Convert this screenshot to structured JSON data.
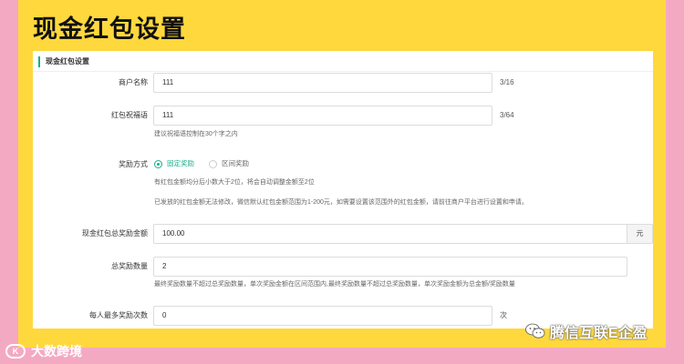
{
  "page_title": "现金红包设置",
  "panel": {
    "title": "现金红包设置"
  },
  "form": {
    "merchant_name": {
      "label": "商户名称",
      "value": "111",
      "counter": "3/16"
    },
    "greeting": {
      "label": "红包祝福语",
      "value": "111",
      "counter": "3/64",
      "hint": "建议祝福语控制在30个字之内"
    },
    "reward_mode": {
      "label": "奖励方式",
      "options": [
        {
          "label": "固定奖励",
          "selected": true
        },
        {
          "label": "区间奖励",
          "selected": false
        }
      ],
      "hint1": "有红包金额均分后小数大于2位，将会自动调整金额至2位",
      "hint2": "已发放的红包金额无法修改，微信默认红包金额范围为1-200元，如需要设置该范围外的红包金额，请前往商户平台进行设置和申请。"
    },
    "total_amount": {
      "label": "现金红包总奖励金额",
      "value": "100.00",
      "unit": "元"
    },
    "total_count": {
      "label": "总奖励数量",
      "value": "2",
      "hint": "最终奖励数量不超过总奖励数量，单次奖励金额在区间范围内,最终奖励数量不超过总奖励数量，单次奖励金额为总金额/奖励数量"
    },
    "max_per_user": {
      "label": "每人最多奖励次数",
      "value": "0",
      "unit": "次"
    }
  },
  "watermarks": {
    "left": "大数跨境",
    "left_logo": "K",
    "right": "腾信互联E企盈"
  },
  "colors": {
    "accent": "#1aad8c",
    "frame_yellow": "#ffd83d",
    "frame_pink": "#f4a9c3"
  }
}
